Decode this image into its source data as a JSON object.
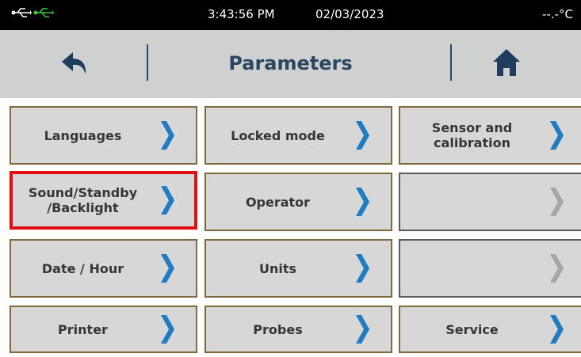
{
  "status": {
    "time": "3:43:56 PM",
    "date": "02/03/2023",
    "temperature": "--.-°C"
  },
  "header": {
    "title": "Parameters"
  },
  "tiles": [
    {
      "label": "Languages",
      "enabled": true,
      "selected": false
    },
    {
      "label": "Locked mode",
      "enabled": true,
      "selected": false
    },
    {
      "label": "Sensor and calibration",
      "enabled": true,
      "selected": false
    },
    {
      "label": "Sound/Standby /Backlight",
      "enabled": true,
      "selected": true
    },
    {
      "label": "Operator",
      "enabled": true,
      "selected": false
    },
    {
      "label": "",
      "enabled": false,
      "selected": false
    },
    {
      "label": "Date / Hour",
      "enabled": true,
      "selected": false
    },
    {
      "label": "Units",
      "enabled": true,
      "selected": false
    },
    {
      "label": "",
      "enabled": false,
      "selected": false
    },
    {
      "label": "Printer",
      "enabled": true,
      "selected": false
    },
    {
      "label": "Probes",
      "enabled": true,
      "selected": false
    },
    {
      "label": "Service",
      "enabled": true,
      "selected": false
    }
  ],
  "colors": {
    "accent": "#1f7cc0",
    "disabled_chevron": "#a6a6a6",
    "selected_border": "#e01010",
    "header_text": "#2a4660"
  },
  "icons": {
    "usb_1": "usb-icon",
    "usb_2": "usb-icon-green",
    "back": "back-arrow-icon",
    "home": "home-icon",
    "chevron": "chevron-right-icon"
  }
}
